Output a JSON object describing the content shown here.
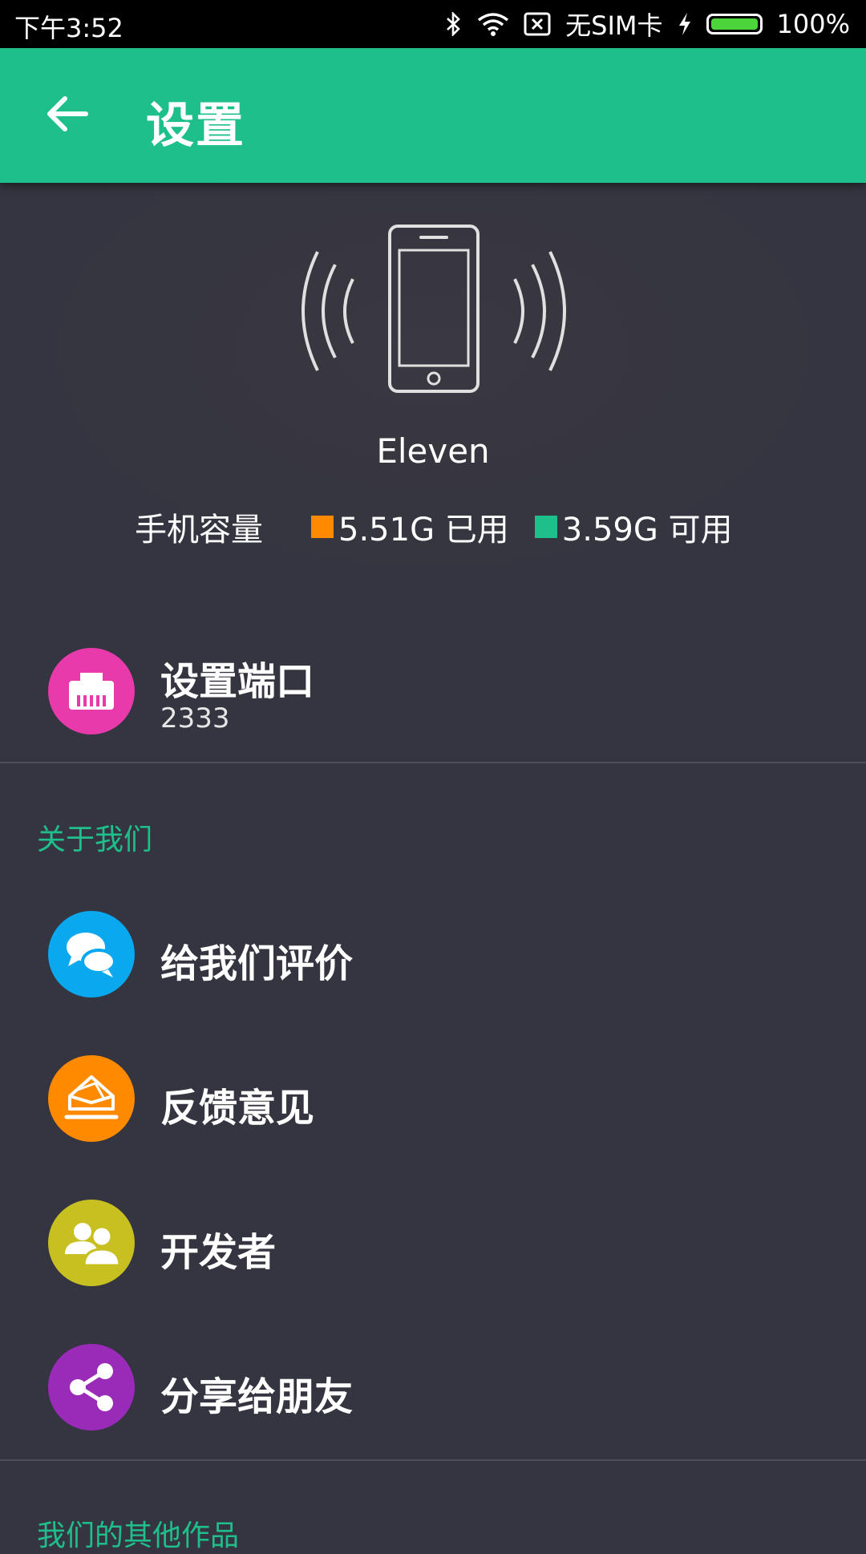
{
  "status_bar": {
    "time": "下午3:52",
    "sim_text": "无SIM卡",
    "battery_text": "100%",
    "battery_level": 1.0,
    "icons": [
      "bluetooth-icon",
      "wifi-icon",
      "no-sim-icon",
      "charging-icon",
      "battery-icon"
    ]
  },
  "app_bar": {
    "title": "设置",
    "back_icon": "arrow-left-icon",
    "color": "#1fbf8b"
  },
  "device": {
    "name": "Eleven",
    "storage_label": "手机容量",
    "used_text": "5.51G 已用",
    "used_color": "#ff8a00",
    "available_text": "3.59G 可用",
    "available_color": "#1fbf8b"
  },
  "port_setting": {
    "title": "设置端口",
    "value": "2333",
    "icon": "ethernet-port-icon",
    "icon_color": "#e83aaa"
  },
  "sections": {
    "about_us": "关于我们",
    "other_works": "我们的其他作品"
  },
  "about_items": [
    {
      "label": "给我们评价",
      "icon": "chat-bubbles-icon",
      "color": "#0aa8ee"
    },
    {
      "label": "反馈意见",
      "icon": "mail-icon",
      "color": "#ff8a00"
    },
    {
      "label": "开发者",
      "icon": "people-icon",
      "color": "#c8c020"
    },
    {
      "label": "分享给朋友",
      "icon": "share-icon",
      "color": "#9a2ab8"
    }
  ]
}
